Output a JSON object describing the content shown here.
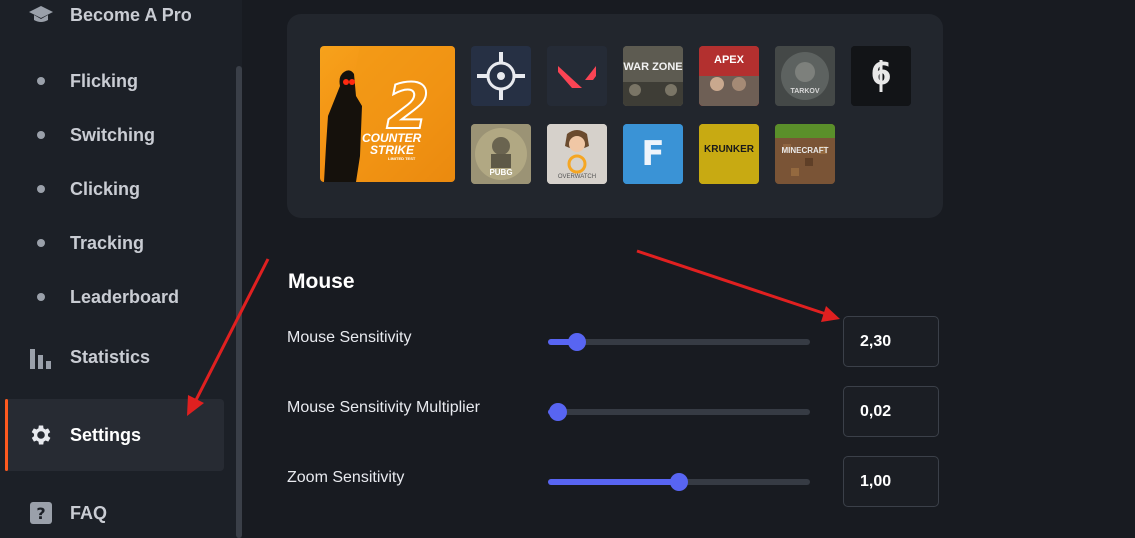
{
  "sidebar": {
    "top_item": {
      "label": "Become A Pro",
      "icon": "graduation-cap-icon"
    },
    "items": [
      {
        "label": "Flicking",
        "icon": "bullet-dot"
      },
      {
        "label": "Switching",
        "icon": "bullet-dot"
      },
      {
        "label": "Clicking",
        "icon": "bullet-dot"
      },
      {
        "label": "Tracking",
        "icon": "bullet-dot"
      },
      {
        "label": "Leaderboard",
        "icon": "bullet-dot"
      }
    ],
    "statistics": {
      "label": "Statistics",
      "icon": "bar-chart-icon"
    },
    "settings": {
      "label": "Settings",
      "icon": "gear-icon",
      "active": true
    },
    "faq": {
      "label": "FAQ",
      "icon": "question-icon"
    }
  },
  "games": {
    "featured": {
      "name": "Counter Strike 2",
      "line1": "COUNTER",
      "line2": "STRIKE",
      "badge": "LIMITED TEST",
      "big_number": "2"
    },
    "tiles": [
      {
        "name": "Aim target"
      },
      {
        "name": "Valorant"
      },
      {
        "name": "Warzone",
        "text": "WAR ZONE"
      },
      {
        "name": "Apex Legends",
        "text": "APEX"
      },
      {
        "name": "Escape from Tarkov",
        "text": "TARKOV"
      },
      {
        "name": "Rainbow Six",
        "text": "6"
      },
      {
        "name": "PUBG",
        "text": "PUBG"
      },
      {
        "name": "Overwatch",
        "text": "OVERWATCH"
      },
      {
        "name": "Fortnite",
        "text": "F"
      },
      {
        "name": "Krunker",
        "text": "KRUNKER"
      },
      {
        "name": "Minecraft",
        "text": "MINECRAFT"
      }
    ]
  },
  "mouse": {
    "title": "Mouse",
    "settings": [
      {
        "label": "Mouse Sensitivity",
        "value": "2,30",
        "slider_fraction": 0.11
      },
      {
        "label": "Mouse Sensitivity Multiplier",
        "value": "0,02",
        "slider_fraction": 0.04
      },
      {
        "label": "Zoom Sensitivity",
        "value": "1,00",
        "slider_fraction": 0.5
      }
    ]
  },
  "colors": {
    "accent": "#5865f2",
    "active_indicator": "#ff5a1f",
    "annotation_arrow": "#e02020"
  }
}
